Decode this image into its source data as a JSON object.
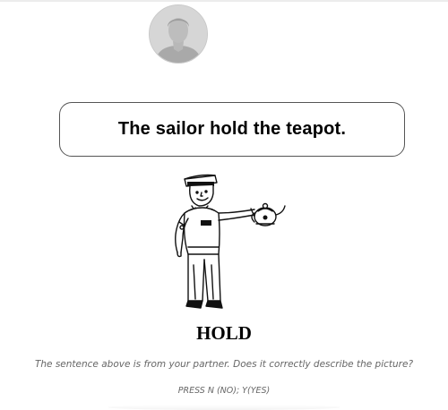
{
  "partner": {
    "avatar_icon": "user-silhouette-icon"
  },
  "sentence": {
    "text": "The sailor hold the teapot."
  },
  "picture": {
    "icon": "sailor-holding-teapot-drawing",
    "caption": "HOLD"
  },
  "prompt": {
    "question": "The sentence above is from your partner. Does it correctly describe the picture?",
    "keys": "PRESS N (NO); Y(YES)"
  }
}
